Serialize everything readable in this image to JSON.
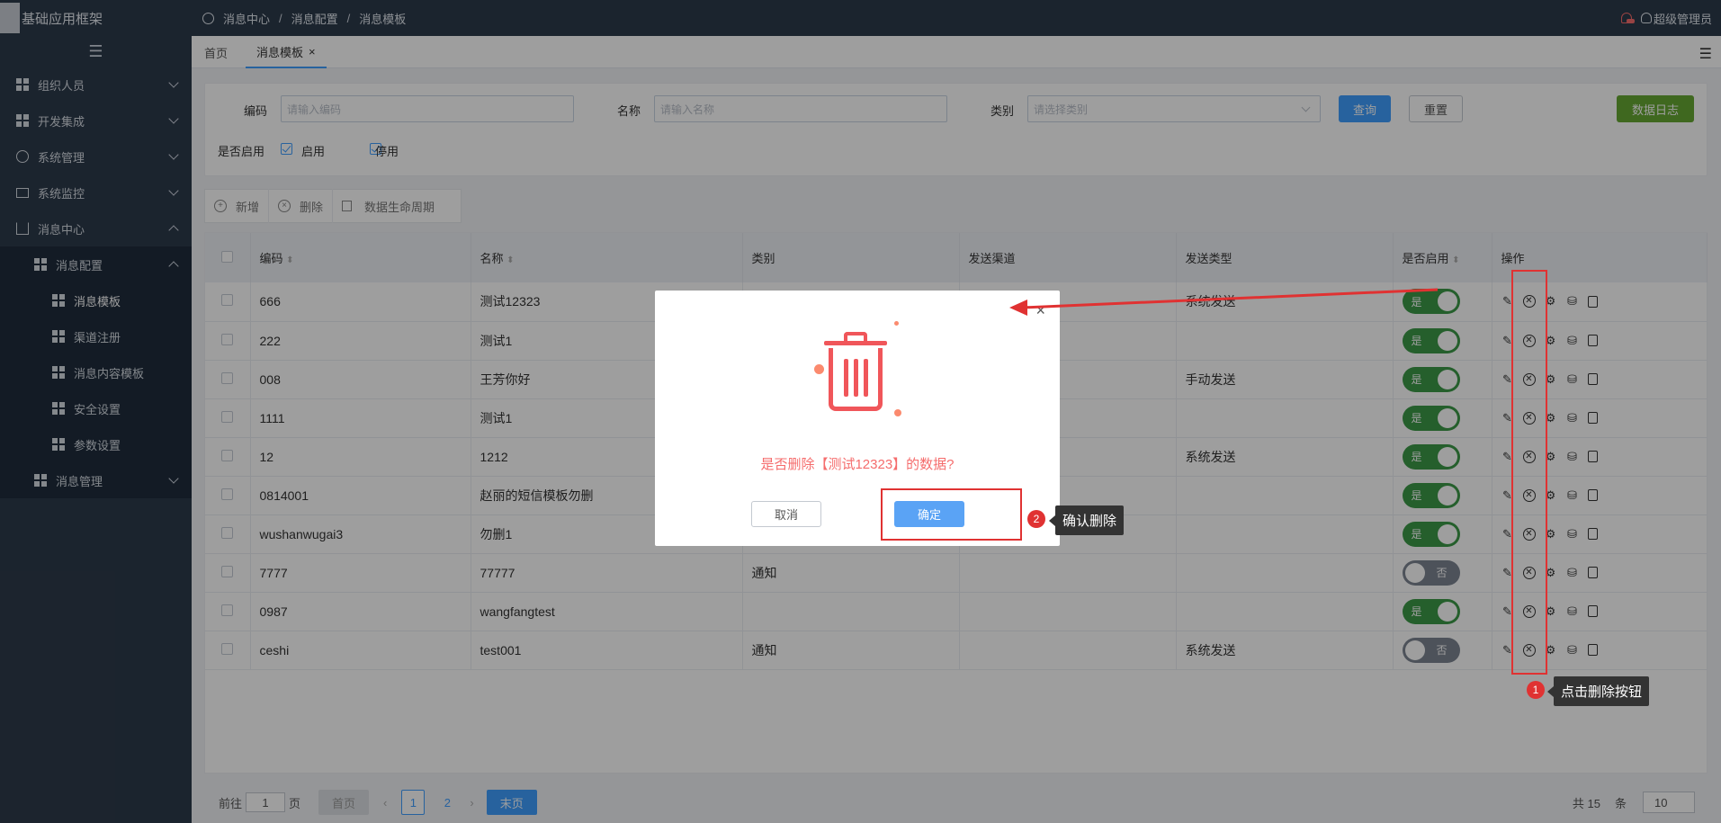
{
  "app": {
    "title": "基础应用框架"
  },
  "breadcrumb": [
    "消息中心",
    "消息配置",
    "消息模板"
  ],
  "user": {
    "name": "超级管理员"
  },
  "sidebar": {
    "items": [
      {
        "label": "组织人员",
        "icon": "grid-icon"
      },
      {
        "label": "开发集成",
        "icon": "grid-icon"
      },
      {
        "label": "系统管理",
        "icon": "gears-icon"
      },
      {
        "label": "系统监控",
        "icon": "monitor-icon"
      },
      {
        "label": "消息中心",
        "icon": "home-icon"
      },
      {
        "label": "消息配置",
        "icon": "grid-icon"
      },
      {
        "label": "消息模板",
        "icon": "grid-icon"
      },
      {
        "label": "渠道注册",
        "icon": "grid-icon"
      },
      {
        "label": "消息内容模板",
        "icon": "grid-icon"
      },
      {
        "label": "安全设置",
        "icon": "grid-icon"
      },
      {
        "label": "参数设置",
        "icon": "grid-icon"
      },
      {
        "label": "消息管理",
        "icon": "grid-icon"
      }
    ]
  },
  "tabs": [
    {
      "label": "首页"
    },
    {
      "label": "消息模板"
    }
  ],
  "filter": {
    "code_label": "编码",
    "code_placeholder": "请输入编码",
    "name_label": "名称",
    "name_placeholder": "请输入名称",
    "type_label": "类别",
    "type_placeholder": "请选择类别",
    "query": "查询",
    "reset": "重置",
    "log": "数据日志",
    "enabled_label": "是否启用",
    "opt_enable": "启用",
    "opt_disable": "停用"
  },
  "toolbar": {
    "add": "新增",
    "delete": "删除",
    "lifecycle": "数据生命周期"
  },
  "table": {
    "headers": [
      "编码",
      "名称",
      "类别",
      "发送渠道",
      "发送类型",
      "是否启用",
      "操作"
    ],
    "rows": [
      {
        "code": "666",
        "name": "测试12323",
        "type": "",
        "channel": "",
        "send_type": "系统发送",
        "enabled": "是"
      },
      {
        "code": "222",
        "name": "测试1",
        "type": "",
        "channel": "",
        "send_type": "",
        "enabled": "是"
      },
      {
        "code": "008",
        "name": "王芳你好",
        "type": "",
        "channel": "",
        "send_type": "手动发送",
        "enabled": "是"
      },
      {
        "code": "1111",
        "name": "测试1",
        "type": "",
        "channel": "",
        "send_type": "",
        "enabled": "是"
      },
      {
        "code": "12",
        "name": "1212",
        "type": "",
        "channel": "",
        "send_type": "系统发送",
        "enabled": "是"
      },
      {
        "code": "0814001",
        "name": "赵丽的短信模板勿删",
        "type": "",
        "channel": "",
        "send_type": "",
        "enabled": "是"
      },
      {
        "code": "wushanwugai3",
        "name": "勿删1",
        "type": "",
        "channel": "",
        "send_type": "",
        "enabled": "是"
      },
      {
        "code": "7777",
        "name": "77777",
        "type": "通知",
        "channel": "",
        "send_type": "",
        "enabled": "否"
      },
      {
        "code": "0987",
        "name": "wangfangtest",
        "type": "",
        "channel": "",
        "send_type": "",
        "enabled": "是"
      },
      {
        "code": "ceshi",
        "name": "test001",
        "type": "通知",
        "channel": "",
        "send_type": "系统发送",
        "enabled": "否"
      }
    ]
  },
  "pager": {
    "goto": "前往",
    "page_input": "1",
    "page_unit": "页",
    "first": "首页",
    "pages": [
      "1",
      "2"
    ],
    "last": "末页",
    "total": "共 15",
    "items_unit": "条",
    "page_size": "10"
  },
  "dialog": {
    "message": "是否删除【测试12323】的数据?",
    "cancel": "取消",
    "confirm": "确定"
  },
  "annotations": {
    "step1_num": "1",
    "step1": "点击删除按钮",
    "step2_num": "2",
    "step2": "确认删除"
  },
  "colors": {
    "sidebar": "#2d3a4b",
    "primary": "#409eff",
    "success": "#3c9a48",
    "danger": "#f56c6c",
    "log_button": "#67a832",
    "annotation": "#e03232"
  }
}
